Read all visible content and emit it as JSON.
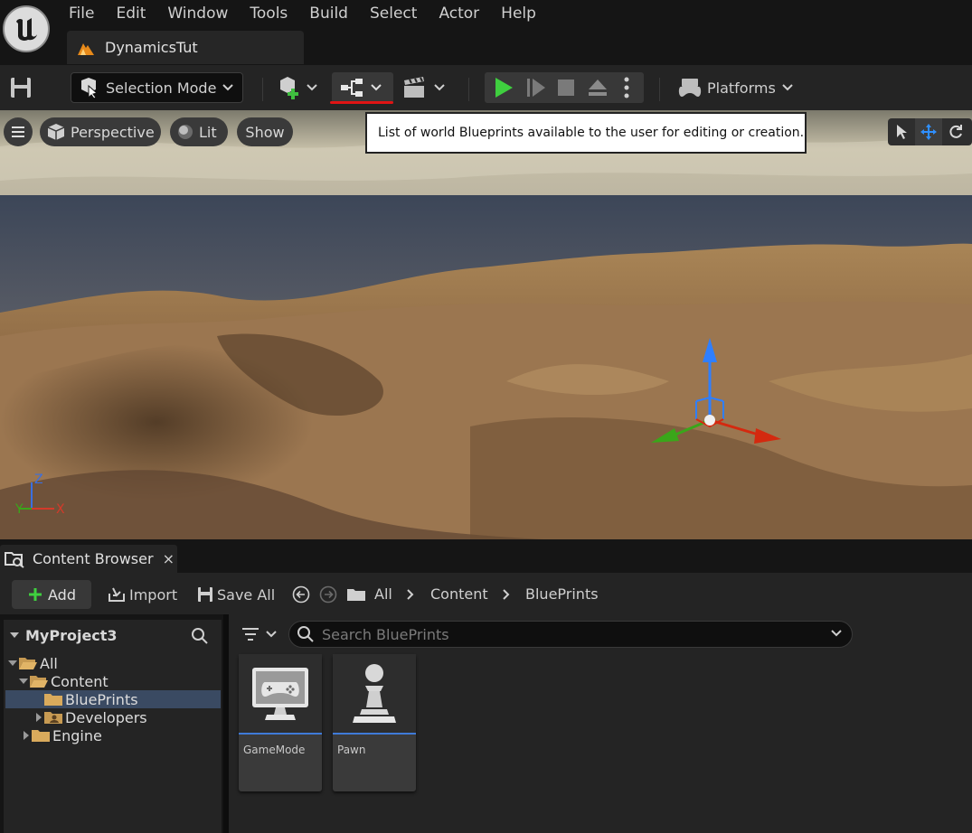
{
  "menu": {
    "items": [
      "File",
      "Edit",
      "Window",
      "Tools",
      "Build",
      "Select",
      "Actor",
      "Help"
    ],
    "level_tab": "DynamicsTut"
  },
  "toolbar": {
    "selection_mode": "Selection Mode",
    "platforms": "Platforms",
    "accent_underline_color": "#e01414"
  },
  "viewport": {
    "perspective": "Perspective",
    "lit": "Lit",
    "show": "Show",
    "tooltip": "List of world Blueprints available to the user for editing or creation.",
    "axis": {
      "z": "Z",
      "y": "Y",
      "x": "X"
    }
  },
  "content_browser": {
    "tab_label": "Content Browser",
    "close_symbol": "×",
    "add": "Add",
    "import": "Import",
    "save_all": "Save All",
    "breadcrumb": [
      "All",
      "Content",
      "BluePrints"
    ],
    "project_name": "MyProject3",
    "search_placeholder": "Search BluePrints",
    "tree": [
      {
        "label": "All",
        "level": 0,
        "expanded": true
      },
      {
        "label": "Content",
        "level": 1,
        "expanded": true
      },
      {
        "label": "BluePrints",
        "level": 2,
        "selected": true
      },
      {
        "label": "Developers",
        "level": 2,
        "expanded": false
      },
      {
        "label": "Engine",
        "level": 1,
        "expanded": false
      }
    ],
    "assets": [
      {
        "name": "GameMode",
        "icon": "gamepad-monitor-icon"
      },
      {
        "name": "Pawn",
        "icon": "pawn-icon"
      }
    ]
  }
}
